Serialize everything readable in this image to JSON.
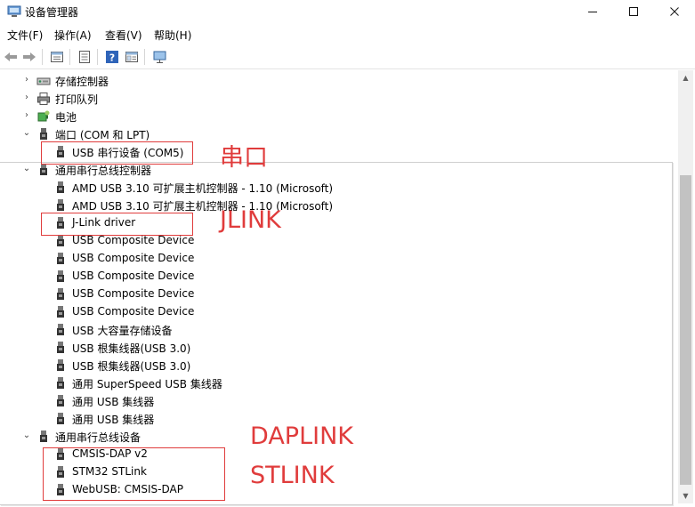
{
  "window": {
    "title": "设备管理器",
    "minimize_glyph": "—",
    "maximize_glyph": "☐",
    "close_glyph": "✕"
  },
  "menu": {
    "file": "文件(F)",
    "action": "操作(A)",
    "view": "查看(V)",
    "help": "帮助(H)"
  },
  "toolbar": {
    "icons": [
      "back-icon",
      "forward-icon",
      "properties-icon",
      "list-icon",
      "help-icon",
      "grid-icon",
      "monitor-icon"
    ]
  },
  "tree": {
    "storage_controllers": "存储控制器",
    "print_queues": "打印队列",
    "battery": "电池",
    "ports": "端口 (COM 和 LPT)",
    "ports_children": [
      "USB 串行设备 (COM5)"
    ],
    "usb_controllers": "通用串行总线控制器",
    "usb_controllers_children": [
      "AMD USB 3.10 可扩展主机控制器 - 1.10 (Microsoft)",
      "AMD USB 3.10 可扩展主机控制器 - 1.10 (Microsoft)",
      "J-Link driver",
      "USB Composite Device",
      "USB Composite Device",
      "USB Composite Device",
      "USB Composite Device",
      "USB Composite Device",
      "USB 大容量存储设备",
      "USB 根集线器(USB 3.0)",
      "USB 根集线器(USB 3.0)",
      "通用 SuperSpeed USB 集线器",
      "通用 USB 集线器",
      "通用 USB 集线器"
    ],
    "usb_devices": "通用串行总线设备",
    "usb_devices_children": [
      "CMSIS-DAP v2",
      "STM32 STLink",
      "WebUSB: CMSIS-DAP"
    ]
  },
  "annotations": {
    "serial": "串口",
    "jlink": "JLINK",
    "daplink": "DAPLINK",
    "stlink": "STLINK"
  },
  "colors": {
    "annotation": "#e03c3c",
    "scrollbar_thumb": "#c2c2c2"
  }
}
